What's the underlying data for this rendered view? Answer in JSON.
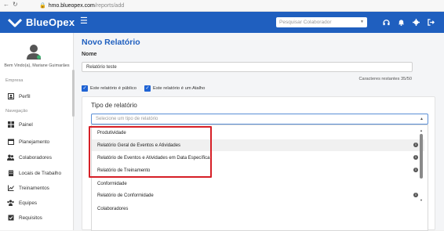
{
  "browser": {
    "url_host": "hmo.blueopex.com",
    "url_path": "/reports/add"
  },
  "topbar": {
    "brand": "BlueOpex",
    "search_placeholder": "Pesquisar Colaborador",
    "brand_color": "#1f5fbf"
  },
  "sidebar": {
    "welcome": "Bem Vindo(a), Mariane Guimarães",
    "section_empresa": "Empresa",
    "section_navegacao": "Navegação",
    "items": [
      {
        "label": "Perfil",
        "icon": "profile-icon"
      },
      {
        "label": "Painel",
        "icon": "dashboard-icon"
      },
      {
        "label": "Planejamento",
        "icon": "calendar-icon"
      },
      {
        "label": "Colaboradores",
        "icon": "users-icon"
      },
      {
        "label": "Locais de Trabalho",
        "icon": "building-icon"
      },
      {
        "label": "Treinamentos",
        "icon": "chart-icon"
      },
      {
        "label": "Equipes",
        "icon": "team-icon"
      },
      {
        "label": "Requisitos",
        "icon": "checklist-icon"
      }
    ]
  },
  "main": {
    "title": "Novo Relatório",
    "name_label": "Nome",
    "name_value": "Relatório teste",
    "chars_remaining": "Caracteres restantes 35/50",
    "check_public": "Este relatório é público",
    "check_shortcut": "Este relatório é um Atalho",
    "type_title": "Tipo de relatório",
    "type_placeholder": "Selecione um tipo de relatório"
  },
  "dropdown": {
    "options": [
      {
        "label": "Produtividade",
        "group": true,
        "info": false
      },
      {
        "label": "Relatório Geral de Eventos e Atividades",
        "group": false,
        "info": true
      },
      {
        "label": "Relatório de Eventos e Atividades em Data Específica",
        "group": false,
        "info": true
      },
      {
        "label": "Relatório de Treinamento",
        "group": false,
        "info": true
      },
      {
        "label": "Conformidade",
        "group": true,
        "info": false
      },
      {
        "label": "Relatório de Conformidade",
        "group": false,
        "info": true
      },
      {
        "label": "Colaboradores",
        "group": true,
        "info": false
      }
    ]
  },
  "annotation": {
    "color": "#d61f26"
  }
}
